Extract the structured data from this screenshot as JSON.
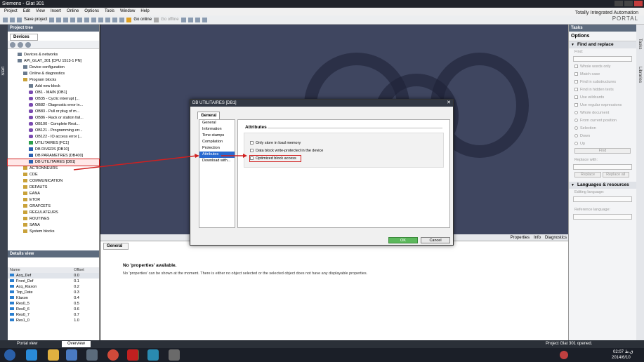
{
  "window": {
    "title": "Siemens - Glat 301"
  },
  "brand": {
    "line1": "Totally Integrated Automation",
    "line2": "PORTAL"
  },
  "menu": [
    "Project",
    "Edit",
    "View",
    "Insert",
    "Online",
    "Options",
    "Tools",
    "Window",
    "Help"
  ],
  "toolbar": {
    "save_label": "Save project",
    "go_online": "Go online",
    "go_offline": "Go offline"
  },
  "start_strip": "Start",
  "project_tree": {
    "header": "Project tree",
    "devices_tab": "Devices",
    "items": [
      {
        "label": "Devices & networks",
        "icon": "dev"
      },
      {
        "label": "API_GLAT_301 [CPU 1513-1 PN]",
        "icon": "dev"
      },
      {
        "label": "Device configuration",
        "icon": "dev"
      },
      {
        "label": "Online & diagnostics",
        "icon": "dev"
      },
      {
        "label": "Program blocks",
        "icon": "fold"
      },
      {
        "label": "Add new block",
        "icon": "dev"
      },
      {
        "label": "OB1 - MAIN [OB1]",
        "icon": "ob"
      },
      {
        "label": "OB35 - Cyclic interrupt [...",
        "icon": "ob"
      },
      {
        "label": "OB82 - Diagnostic error in...",
        "icon": "ob"
      },
      {
        "label": "OB83 - Pull or plug of m...",
        "icon": "ob"
      },
      {
        "label": "OB86 - Rack or station fail...",
        "icon": "ob"
      },
      {
        "label": "OB100 - Complete Rest...",
        "icon": "ob"
      },
      {
        "label": "OB121 - Programming err...",
        "icon": "ob"
      },
      {
        "label": "OB122 - IO access error [...",
        "icon": "ob"
      },
      {
        "label": "UTILITAIRES [FC1]",
        "icon": "fc"
      },
      {
        "label": "DB DIVERS [DB10]",
        "icon": "db"
      },
      {
        "label": "DB PARAMETRES [DB400]",
        "icon": "db"
      },
      {
        "label": "DB UTILITAIRES [DB1]",
        "icon": "db"
      },
      {
        "label": "ACTIONNEURS",
        "icon": "fold"
      },
      {
        "label": "CDE",
        "icon": "fold"
      },
      {
        "label": "COMMUNICATION",
        "icon": "fold"
      },
      {
        "label": "DEFAUTS",
        "icon": "fold"
      },
      {
        "label": "EANA",
        "icon": "fold"
      },
      {
        "label": "ETOR",
        "icon": "fold"
      },
      {
        "label": "GRAFCETS",
        "icon": "fold"
      },
      {
        "label": "REGULATEURS",
        "icon": "fold"
      },
      {
        "label": "ROUTINES",
        "icon": "fold"
      },
      {
        "label": "SANA",
        "icon": "fold"
      },
      {
        "label": "System blocks",
        "icon": "fold"
      }
    ]
  },
  "details_view": {
    "header": "Details view",
    "columns": [
      "Name",
      "Offset"
    ],
    "rows": [
      [
        "Acq_Def",
        "0.0"
      ],
      [
        "Front_Def",
        "0.1"
      ],
      [
        "Acq_Klaxon",
        "0.2"
      ],
      [
        "Top_Date",
        "0.3"
      ],
      [
        "Klaxon",
        "0.4"
      ],
      [
        "Res0_5",
        "0.5"
      ],
      [
        "Res0_6",
        "0.6"
      ],
      [
        "Res0_7",
        "0.7"
      ],
      [
        "Res1_0",
        "1.0"
      ]
    ]
  },
  "inspector": {
    "general_tab": "General",
    "properties_tab": "Properties",
    "info_tab": "Info",
    "diagnostics_tab": "Diagnostics",
    "message_title": "No 'properties' available.",
    "message_body": "No 'properties' can be shown at the moment. There is either no object selected or the selected object does not have any displayable properties."
  },
  "dialog": {
    "title": "DB UTILITAIRES [DB1]",
    "general_tab": "General",
    "nav": [
      "General",
      "Information",
      "Time stamps",
      "Compilation",
      "Protection",
      "Attributes",
      "Download with..."
    ],
    "section_title": "Attributes",
    "options": [
      "Only store in load memory",
      "Data block write-protected in the device",
      "Optimized block access"
    ],
    "ok": "OK",
    "cancel": "Cancel"
  },
  "tasks": {
    "header": "Tasks",
    "options": "Options",
    "find_replace": "Find and replace",
    "find_label": "Find:",
    "checks": [
      "Whole words only",
      "Match case",
      "Find in substructures",
      "Find in hidden texts",
      "Use wildcards",
      "Use regular expressions"
    ],
    "radios": [
      "Whole document",
      "From current position",
      "Selection"
    ],
    "dir": [
      "Down",
      "Up"
    ],
    "find_btn": "Find",
    "replace_with": "Replace with:",
    "replace_btn": "Replace",
    "replace_all_btn": "Replace all",
    "lang_res": "Languages & resources",
    "editing_lang": "Editing language:",
    "reference_lang": "Reference language:"
  },
  "side_tabs": [
    "Tasks",
    "Libraries"
  ],
  "statusbar": {
    "portal_view": "Portal view",
    "overview": "Overview",
    "status": "Project Glat 301 opened."
  },
  "clock": {
    "time": "ق.ظ 02:07",
    "date": "2014/6/10"
  }
}
